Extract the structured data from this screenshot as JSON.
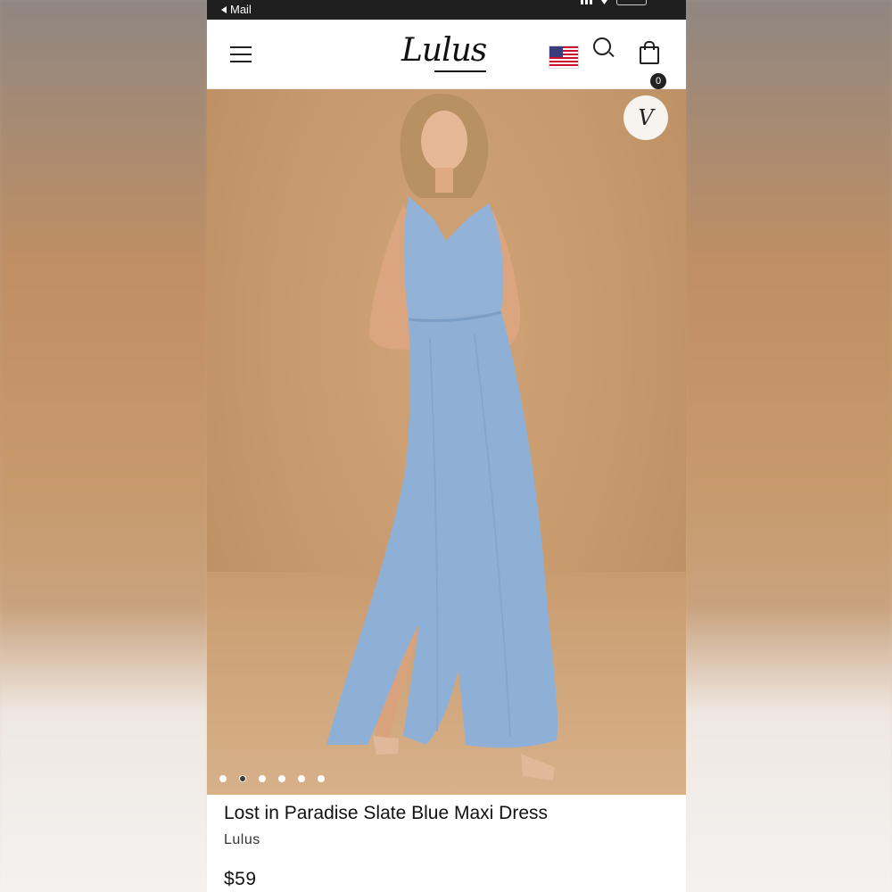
{
  "status_bar": {
    "back_label": "Mail"
  },
  "header": {
    "logo": "Lulus",
    "cart_count": "0",
    "icons": [
      "menu-icon",
      "us-flag-icon",
      "search-icon",
      "shopping-bag-icon"
    ]
  },
  "gallery": {
    "wishlist_icon": "V",
    "image_count": 6,
    "active_index": 1
  },
  "product": {
    "title": "Lost in Paradise Slate Blue Maxi Dress",
    "brand": "Lulus",
    "price": "$59"
  },
  "colors": {
    "dress": "#8fb0d6",
    "background": "#c69a6d",
    "text": "#111111"
  }
}
